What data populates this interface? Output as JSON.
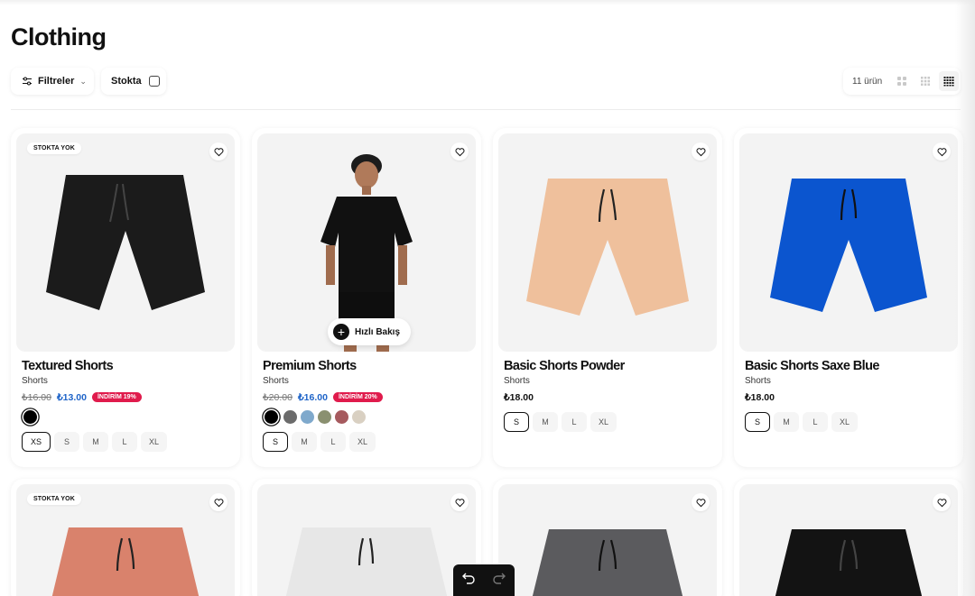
{
  "page": {
    "title": "Clothing"
  },
  "toolbar": {
    "filter_label": "Filtreler",
    "stock_label": "Stokta",
    "count_label": "11 ürün",
    "view_options": [
      "grid-2-icon",
      "grid-3-icon",
      "grid-4-icon"
    ]
  },
  "quick_view_label": "Hızlı Bakış",
  "products": [
    {
      "badge": "STOKTA YOK",
      "name": "Textured Shorts",
      "category": "Shorts",
      "old_price": "₺16.00",
      "price": "₺13.00",
      "discount": "İNDİRİM 19%",
      "colors": [
        "#000000"
      ],
      "sizes": [
        "XS",
        "S",
        "M",
        "L",
        "XL"
      ],
      "selected_size": "XS",
      "product_color": "#1b1b1b"
    },
    {
      "badge": "",
      "name": "Premium Shorts",
      "category": "Shorts",
      "old_price": "₺20.00",
      "price": "₺16.00",
      "discount": "İNDİRİM 20%",
      "colors": [
        "#000000",
        "#6b6b6b",
        "#7fa9cc",
        "#8a9070",
        "#a65a5e",
        "#d9d0c2"
      ],
      "sizes": [
        "S",
        "M",
        "L",
        "XL"
      ],
      "selected_size": "S",
      "product_color": "#111111"
    },
    {
      "badge": "",
      "name": "Basic Shorts Powder",
      "category": "Shorts",
      "old_price": "",
      "price": "₺18.00",
      "discount": "",
      "colors": [],
      "sizes": [
        "S",
        "M",
        "L",
        "XL"
      ],
      "selected_size": "S",
      "product_color": "#efc09c"
    },
    {
      "badge": "",
      "name": "Basic Shorts Saxe Blue",
      "category": "Shorts",
      "old_price": "",
      "price": "₺18.00",
      "discount": "",
      "colors": [],
      "sizes": [
        "S",
        "M",
        "L",
        "XL"
      ],
      "selected_size": "S",
      "product_color": "#0b55cf"
    },
    {
      "badge": "STOKTA YOK",
      "product_color": "#d9826c"
    },
    {
      "badge": "",
      "product_color": "#e7e7e7"
    },
    {
      "badge": "",
      "product_color": "#5b5b5e"
    },
    {
      "badge": "",
      "product_color": "#131313"
    }
  ]
}
